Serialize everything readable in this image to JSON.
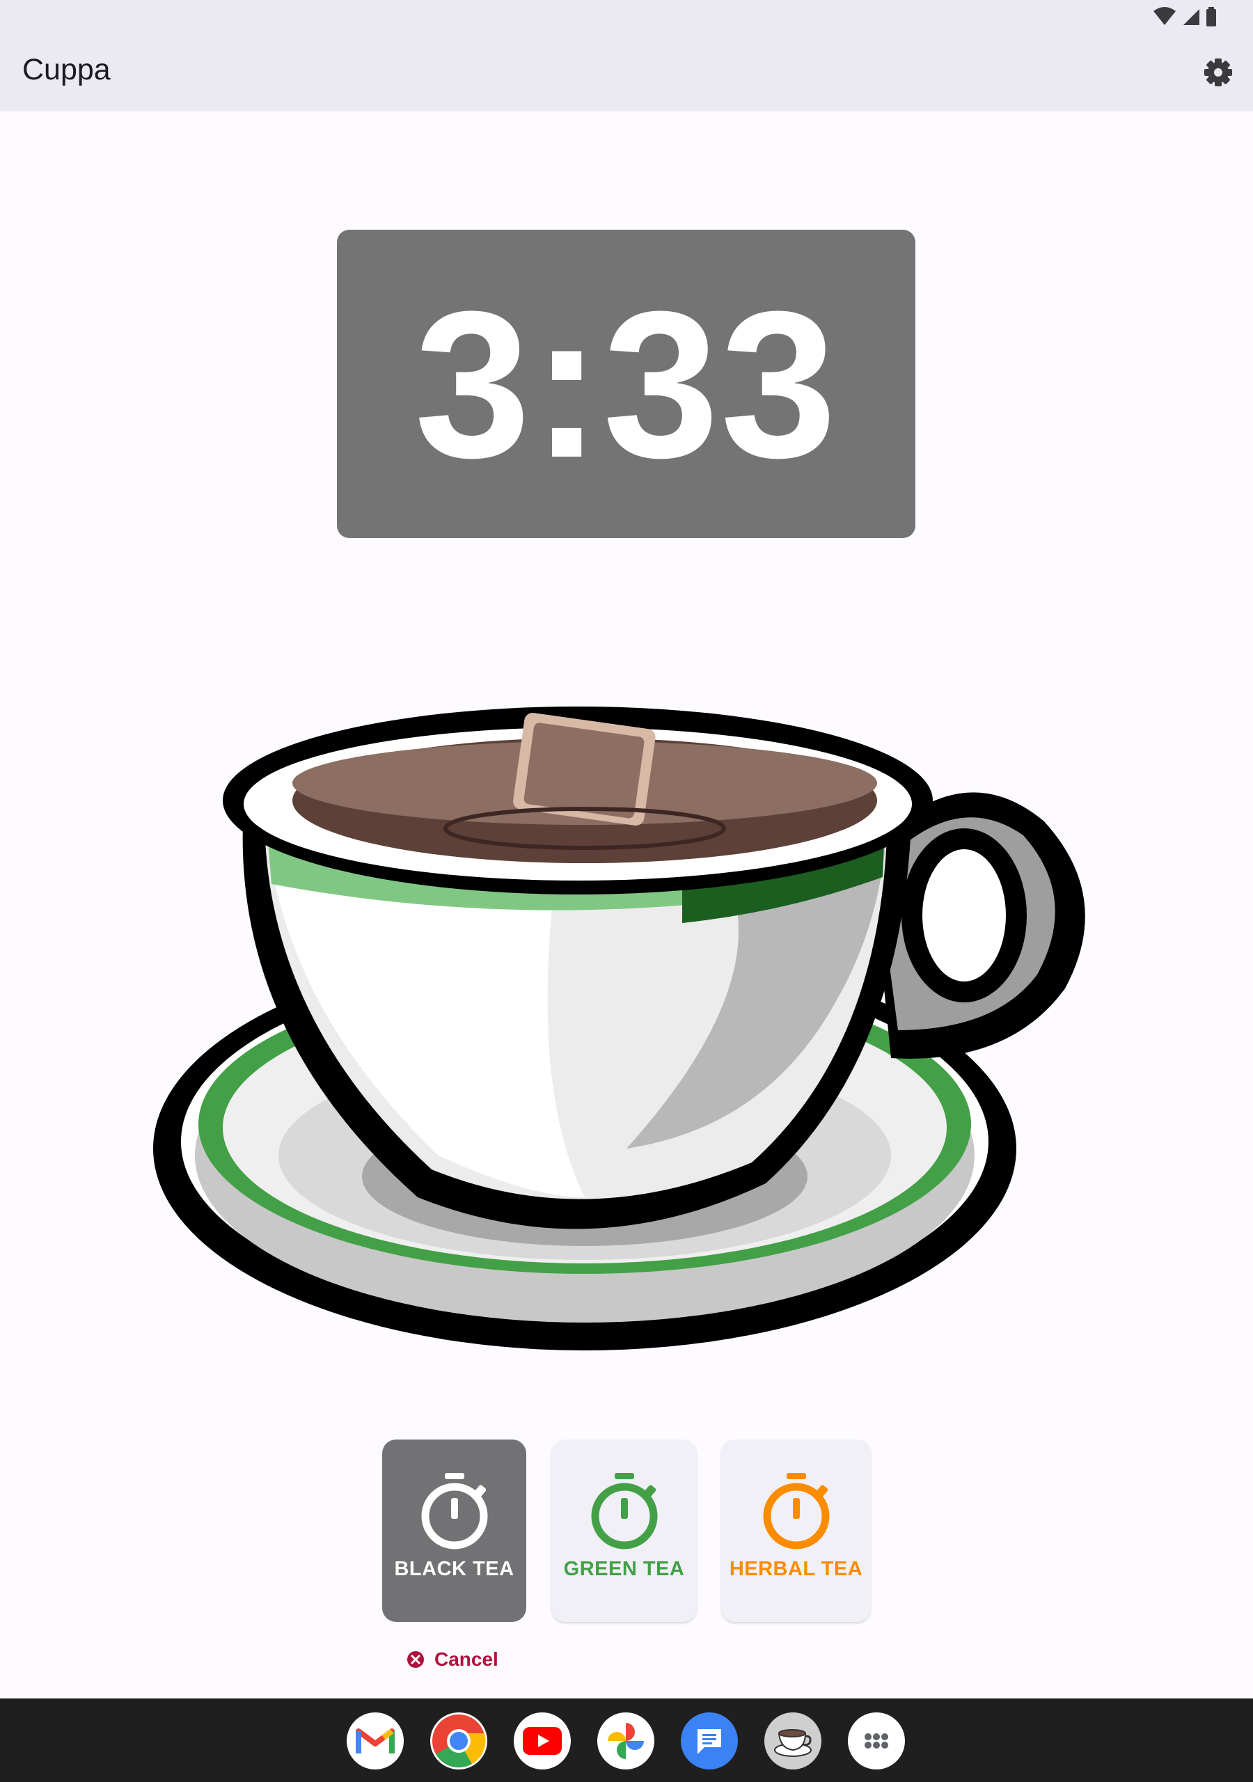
{
  "app": {
    "title": "Cuppa"
  },
  "timer": {
    "display": "3:33"
  },
  "tea_buttons": [
    {
      "label": "BLACK TEA",
      "color": "#ffffff",
      "state": "active"
    },
    {
      "label": "GREEN TEA",
      "color": "#43a047",
      "state": "idle"
    },
    {
      "label": "HERBAL TEA",
      "color": "#fb8c00",
      "state": "idle"
    }
  ],
  "cancel": {
    "label": "Cancel"
  },
  "dock_apps": [
    "gmail-icon",
    "chrome-icon",
    "youtube-icon",
    "photos-icon",
    "messages-icon",
    "cuppa-icon",
    "app-drawer-icon"
  ],
  "colors": {
    "timer_bg": "#747474",
    "active_button": "#727275",
    "cancel": "#b0123d",
    "app_bar": "#ebeaf2"
  }
}
